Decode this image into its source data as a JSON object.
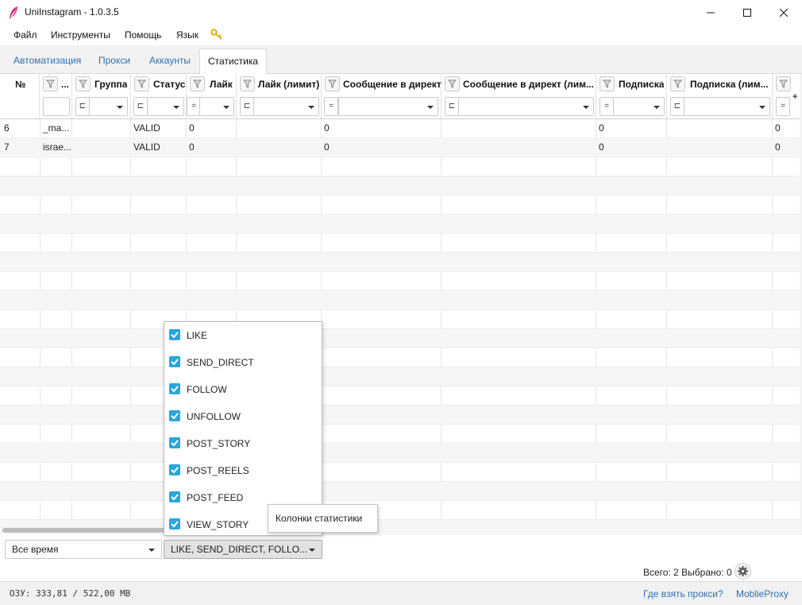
{
  "window": {
    "title": "UniInstagram - 1.0.3.5"
  },
  "menu": {
    "file": "Файл",
    "tools": "Инструменты",
    "help": "Помощь",
    "language": "Язык"
  },
  "tabs": [
    {
      "label": "Автоматизация",
      "active": false
    },
    {
      "label": "Прокси",
      "active": false
    },
    {
      "label": "Аккаунты",
      "active": false
    },
    {
      "label": "Статистика",
      "active": true
    }
  ],
  "table": {
    "columns": [
      {
        "label": "№",
        "filter_op": ""
      },
      {
        "label": "...",
        "filter_op": ""
      },
      {
        "label": "Группа",
        "filter_op": "⊏"
      },
      {
        "label": "Статус",
        "filter_op": "⊏"
      },
      {
        "label": "Лайк",
        "filter_op": "="
      },
      {
        "label": "Лайк (лимит)",
        "filter_op": "⊏"
      },
      {
        "label": "Сообщение в директ",
        "filter_op": "="
      },
      {
        "label": "Сообщение в директ (лим...",
        "filter_op": "⊏"
      },
      {
        "label": "Подписка",
        "filter_op": "="
      },
      {
        "label": "Подписка (лим...",
        "filter_op": "⊏"
      },
      {
        "label": "",
        "filter_op": "="
      }
    ],
    "rows": [
      {
        "num": "6",
        "account": "_ma...",
        "group": "",
        "status": "VALID",
        "like": "0",
        "like_limit": "",
        "direct": "0",
        "direct_limit": "",
        "follow": "0",
        "follow_limit": "",
        "last": "0"
      },
      {
        "num": "7",
        "account": "israe...",
        "group": "",
        "status": "VALID",
        "like": "0",
        "like_limit": "",
        "direct": "0",
        "direct_limit": "",
        "follow": "0",
        "follow_limit": "",
        "last": "0"
      }
    ]
  },
  "stats_dropdown": {
    "items": [
      {
        "label": "LIKE",
        "checked": true
      },
      {
        "label": "SEND_DIRECT",
        "checked": true
      },
      {
        "label": "FOLLOW",
        "checked": true
      },
      {
        "label": "UNFOLLOW",
        "checked": true
      },
      {
        "label": "POST_STORY",
        "checked": true
      },
      {
        "label": "POST_REELS",
        "checked": true
      },
      {
        "label": "POST_FEED",
        "checked": true
      },
      {
        "label": "VIEW_STORY",
        "checked": true
      }
    ]
  },
  "tooltip": "Колонки статистики",
  "footer": {
    "period_value": "Все время",
    "columns_value": "LIKE, SEND_DIRECT, FOLLO...",
    "totals": "Всего: 2  Выбрано: 0"
  },
  "status": {
    "ram": "ОЗУ: 333,81 / 522,00 MB",
    "proxy_link": "Где взять прокси?",
    "mobile_proxy_link": "MoblieProxy"
  },
  "colors": {
    "accent": "#2aa6dc",
    "link": "#2d6fb3",
    "icon_key": "#e0b400",
    "app_icon": "#d63384"
  }
}
